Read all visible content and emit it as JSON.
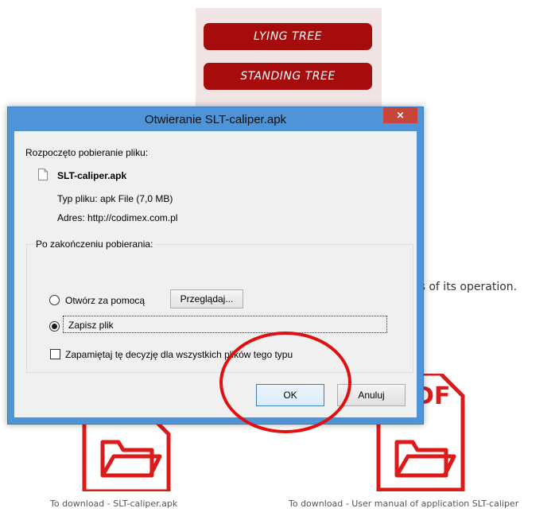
{
  "background_page": {
    "menu": {
      "lying_tree": "LYING TREE",
      "standing_tree": "STANDING TREE"
    },
    "operation_text": "es of its operation.",
    "download_left": "To download - SLT-caliper.apk",
    "download_right": "To download - User manual of application SLT-caliper",
    "pdf_label": "DF"
  },
  "dialog": {
    "title": "Otwieranie SLT-caliper.apk",
    "close_glyph": "×",
    "started_label": "Rozpoczęto pobieranie pliku:",
    "file_name": "SLT-caliper.apk",
    "file_type_label": "Typ pliku:",
    "file_type_value": "apk File (7,0 MB)",
    "address_label": "Adres:",
    "address_value": "http://codimex.com.pl",
    "group_title": "Po zakończeniu pobierania:",
    "open_with_label": "Otwórz za pomocą",
    "browse_button": "Przeglądaj...",
    "save_file_label": "Zapisz plik",
    "remember_label": "Zapamiętaj tę decyzję dla wszystkich plików tego typu",
    "ok_button": "OK",
    "cancel_button": "Anuluj",
    "selected_option": "Zapisz plik"
  },
  "colors": {
    "menu_button": "#a60c0c",
    "title_bar": "#4f94d6",
    "close_button": "#c7453a",
    "highlight_ellipse": "#e01010",
    "file_icon": "#dd1a1a"
  },
  "icons": {
    "dialog_file": "document-icon",
    "download_left": "folder-file-icon",
    "download_right": "pdf-folder-file-icon"
  }
}
